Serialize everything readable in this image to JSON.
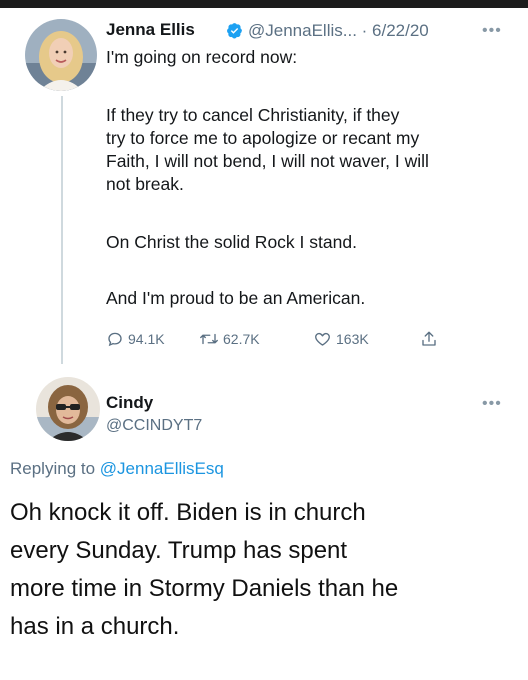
{
  "tweet": {
    "author_name": "Jenna Ellis",
    "author_meta": "@JennaEllis... · 6/22/20",
    "paragraphs": [
      [
        "I'm going on record now:"
      ],
      [
        "If they try to cancel Christianity, if they",
        "try to force me to apologize or recant my",
        "Faith, I will not bend, I will not waver, I will",
        "not break."
      ],
      [
        "On Christ the solid Rock I stand."
      ],
      [
        "And I'm proud to be an American."
      ]
    ],
    "stats": {
      "replies": "94.1K",
      "retweets": "62.7K",
      "likes": "163K"
    },
    "icons": [
      "verified-badge-icon",
      "more-options-icon",
      "reply-icon",
      "retweet-icon",
      "like-icon",
      "share-icon"
    ]
  },
  "reply": {
    "author_name": "Cindy",
    "author_handle": "@CCINDYT7",
    "replying_label": "Replying to",
    "replying_to": "@JennaEllisEsq",
    "text_lines": [
      "Oh knock it off.  Biden is in church",
      "every Sunday.  Trump has spent",
      "more time in Stormy Daniels than he",
      "has in a church."
    ]
  },
  "colors": {
    "link_blue": "#1b95e0",
    "muted_gray": "#5b7083",
    "verified_blue": "#1da1f2"
  }
}
